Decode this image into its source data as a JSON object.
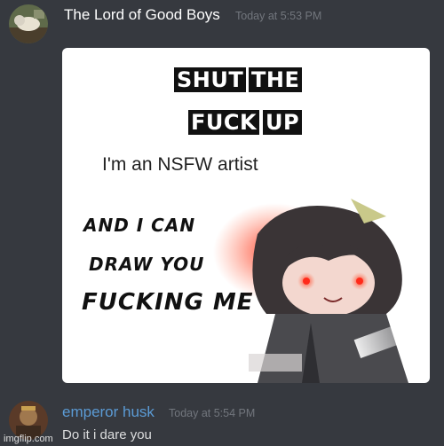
{
  "messages": [
    {
      "username": "The Lord of Good Boys",
      "timestamp": "Today at 5:53 PM",
      "username_color": "#ffffff"
    },
    {
      "username": "emperor husk",
      "timestamp": "Today at 5:54 PM",
      "text": "Do it i dare you",
      "username_color": "#5b9bd5"
    }
  ],
  "meme": {
    "line1_word1": "SHUT",
    "line1_word2": "THE",
    "line2_word1": "FUCK",
    "line2_word2": "UP",
    "line3": "I'm an NSFW artist",
    "line4": "AND I CAN",
    "line5": "DRAW YOU",
    "line6": "FUCKING ME"
  },
  "watermark": "imgflip.com",
  "colors": {
    "background": "#36393f",
    "timestamp": "#72767d",
    "message_text": "#dcddde",
    "glow_red": "#ff2a1a"
  }
}
